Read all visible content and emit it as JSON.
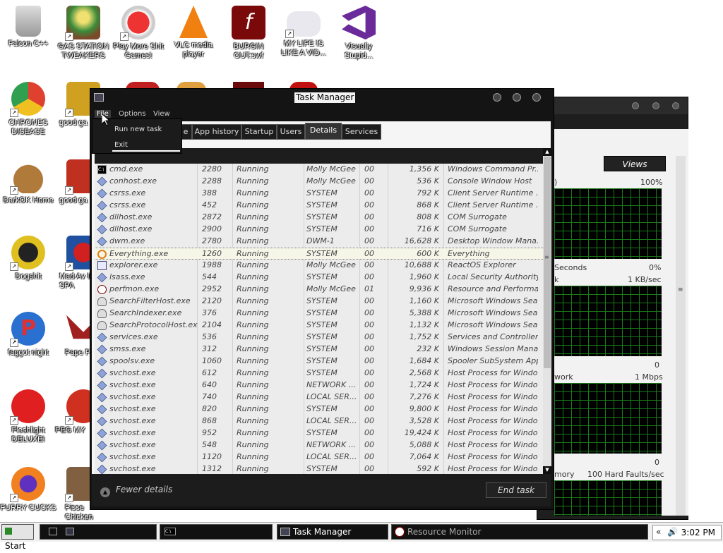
{
  "desktop": {
    "icons": [
      {
        "label": "Falcon C++"
      },
      {
        "label": "GAS STATION TWEAKERS"
      },
      {
        "label": "Play More Shit Games!"
      },
      {
        "label": "VLC media player"
      },
      {
        "label": "BURGIN OUT.swf"
      },
      {
        "label": "MY LIFE IS LIKE A VID..."
      },
      {
        "label": "Visually Stupid..."
      },
      {
        "label": "CHRONES DISEASE"
      },
      {
        "label": "good ga"
      },
      {
        "label": "DarkOK Home"
      },
      {
        "label": "good ga"
      },
      {
        "label": "Dogshit"
      },
      {
        "label": "Mad Av IN SPA"
      },
      {
        "label": "faggot night"
      },
      {
        "label": "Pape Pleas"
      },
      {
        "label": "Fleshlight DELUXE!"
      },
      {
        "label": "PEG MY"
      },
      {
        "label": "FURRY CUCKS"
      },
      {
        "label": "Pisse Chicken"
      }
    ]
  },
  "resource_monitor": {
    "views_label": "Views",
    "cpu_pct": "100%",
    "cpu_footer_left": "Seconds",
    "cpu_footer_right": "0%",
    "disk_left": "k",
    "disk_right": "1 KB/sec",
    "disk_zero": "0",
    "net_left": "work",
    "net_right": "1 Mbps",
    "net_zero": "0",
    "mem_left": "mory",
    "mem_right": "100 Hard Faults/sec"
  },
  "task_manager": {
    "title": "Task Manager",
    "menu": {
      "file": "File",
      "options": "Options",
      "view": "View"
    },
    "file_menu": {
      "run_new_task": "Run new task",
      "exit": "Exit"
    },
    "tabs": [
      {
        "label": "e"
      },
      {
        "label": "App history"
      },
      {
        "label": "Startup"
      },
      {
        "label": "Users"
      },
      {
        "label": "Details"
      },
      {
        "label": "Services"
      }
    ],
    "rows": [
      {
        "name": "cmd.exe",
        "pid": "2280",
        "status": "Running",
        "user": "Molly McGee",
        "cpu": "00",
        "mem": "1,356 K",
        "desc": "Windows Command Pr..."
      },
      {
        "name": "conhost.exe",
        "pid": "2288",
        "status": "Running",
        "user": "Molly McGee",
        "cpu": "00",
        "mem": "536 K",
        "desc": "Console Window Host"
      },
      {
        "name": "csrss.exe",
        "pid": "388",
        "status": "Running",
        "user": "SYSTEM",
        "cpu": "00",
        "mem": "792 K",
        "desc": "Client Server Runtime ..."
      },
      {
        "name": "csrss.exe",
        "pid": "452",
        "status": "Running",
        "user": "SYSTEM",
        "cpu": "00",
        "mem": "868 K",
        "desc": "Client Server Runtime ..."
      },
      {
        "name": "dllhost.exe",
        "pid": "2872",
        "status": "Running",
        "user": "SYSTEM",
        "cpu": "00",
        "mem": "808 K",
        "desc": "COM Surrogate"
      },
      {
        "name": "dllhost.exe",
        "pid": "2900",
        "status": "Running",
        "user": "SYSTEM",
        "cpu": "00",
        "mem": "716 K",
        "desc": "COM Surrogate"
      },
      {
        "name": "dwm.exe",
        "pid": "2780",
        "status": "Running",
        "user": "DWM-1",
        "cpu": "00",
        "mem": "16,628 K",
        "desc": "Desktop Window Mana..."
      },
      {
        "name": "Everything.exe",
        "pid": "1260",
        "status": "Running",
        "user": "SYSTEM",
        "cpu": "00",
        "mem": "600 K",
        "desc": "Everything"
      },
      {
        "name": "explorer.exe",
        "pid": "1988",
        "status": "Running",
        "user": "Molly McGee",
        "cpu": "00",
        "mem": "10,688 K",
        "desc": "ReactOS Explorer"
      },
      {
        "name": "lsass.exe",
        "pid": "544",
        "status": "Running",
        "user": "SYSTEM",
        "cpu": "00",
        "mem": "1,960 K",
        "desc": "Local Security Authority..."
      },
      {
        "name": "perfmon.exe",
        "pid": "2952",
        "status": "Running",
        "user": "Molly McGee",
        "cpu": "01",
        "mem": "9,936 K",
        "desc": "Resource and Performa..."
      },
      {
        "name": "SearchFilterHost.exe",
        "pid": "2120",
        "status": "Running",
        "user": "SYSTEM",
        "cpu": "00",
        "mem": "1,160 K",
        "desc": "Microsoft Windows Sea..."
      },
      {
        "name": "SearchIndexer.exe",
        "pid": "376",
        "status": "Running",
        "user": "SYSTEM",
        "cpu": "00",
        "mem": "5,388 K",
        "desc": "Microsoft Windows Sea..."
      },
      {
        "name": "SearchProtocolHost.exe",
        "pid": "2104",
        "status": "Running",
        "user": "SYSTEM",
        "cpu": "00",
        "mem": "1,132 K",
        "desc": "Microsoft Windows Sea..."
      },
      {
        "name": "services.exe",
        "pid": "536",
        "status": "Running",
        "user": "SYSTEM",
        "cpu": "00",
        "mem": "1,752 K",
        "desc": "Services and Controller ..."
      },
      {
        "name": "smss.exe",
        "pid": "312",
        "status": "Running",
        "user": "SYSTEM",
        "cpu": "00",
        "mem": "232 K",
        "desc": "Windows Session Mana..."
      },
      {
        "name": "spoolsv.exe",
        "pid": "1060",
        "status": "Running",
        "user": "SYSTEM",
        "cpu": "00",
        "mem": "1,684 K",
        "desc": "Spooler SubSystem App"
      },
      {
        "name": "svchost.exe",
        "pid": "612",
        "status": "Running",
        "user": "SYSTEM",
        "cpu": "00",
        "mem": "2,568 K",
        "desc": "Host Process for Windo..."
      },
      {
        "name": "svchost.exe",
        "pid": "640",
        "status": "Running",
        "user": "NETWORK ...",
        "cpu": "00",
        "mem": "1,724 K",
        "desc": "Host Process for Windo..."
      },
      {
        "name": "svchost.exe",
        "pid": "740",
        "status": "Running",
        "user": "LOCAL SER...",
        "cpu": "00",
        "mem": "7,276 K",
        "desc": "Host Process for Windo..."
      },
      {
        "name": "svchost.exe",
        "pid": "820",
        "status": "Running",
        "user": "SYSTEM",
        "cpu": "00",
        "mem": "9,800 K",
        "desc": "Host Process for Windo..."
      },
      {
        "name": "svchost.exe",
        "pid": "868",
        "status": "Running",
        "user": "LOCAL SER...",
        "cpu": "00",
        "mem": "3,528 K",
        "desc": "Host Process for Windo..."
      },
      {
        "name": "svchost.exe",
        "pid": "952",
        "status": "Running",
        "user": "SYSTEM",
        "cpu": "00",
        "mem": "19,424 K",
        "desc": "Host Process for Windo..."
      },
      {
        "name": "svchost.exe",
        "pid": "548",
        "status": "Running",
        "user": "NETWORK ...",
        "cpu": "00",
        "mem": "5,088 K",
        "desc": "Host Process for Windo..."
      },
      {
        "name": "svchost.exe",
        "pid": "1120",
        "status": "Running",
        "user": "LOCAL SER...",
        "cpu": "00",
        "mem": "7,064 K",
        "desc": "Host Process for Windo..."
      },
      {
        "name": "svchost.exe",
        "pid": "1312",
        "status": "Running",
        "user": "SYSTEM",
        "cpu": "00",
        "mem": "592 K",
        "desc": "Host Process for Windo..."
      }
    ],
    "fewer_details": "Fewer details",
    "end_task": "End task"
  },
  "taskbar": {
    "start": "Start",
    "apps": [
      {
        "label": "Task Manager"
      },
      {
        "label": "Resource Monitor"
      }
    ],
    "clock": "3:02 PM"
  }
}
